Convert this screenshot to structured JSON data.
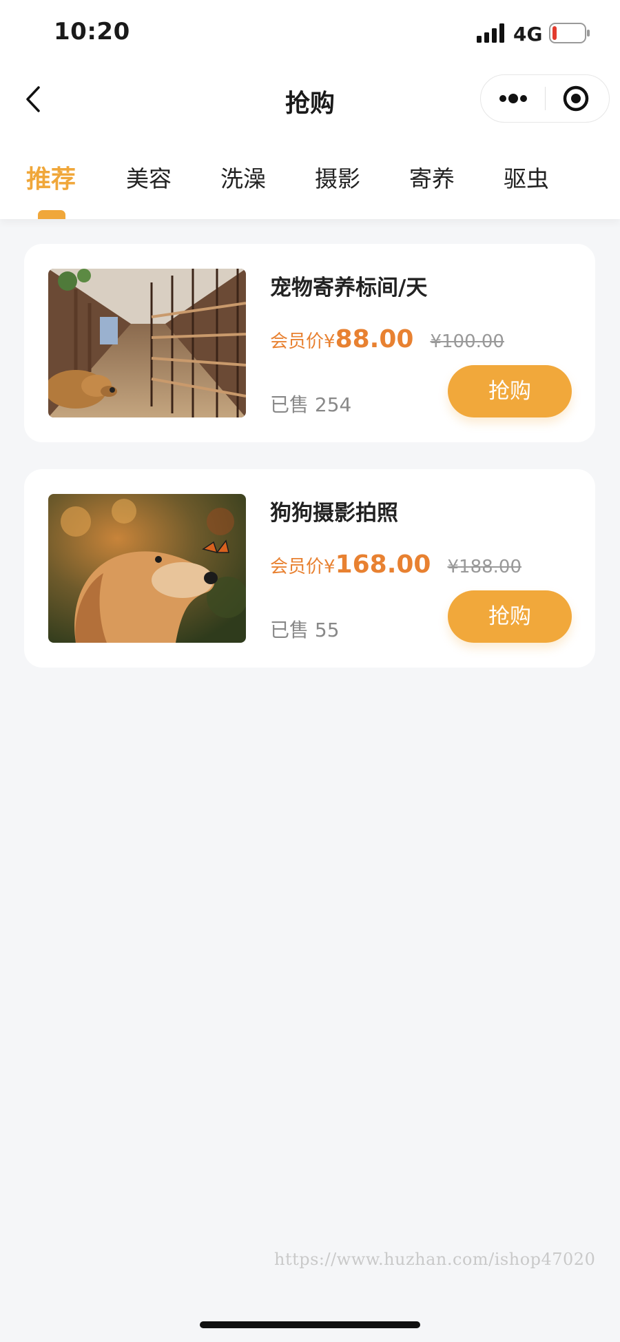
{
  "status_bar": {
    "time": "10:20",
    "network": "4G",
    "signal_icon": "signal-bars-icon",
    "battery_icon": "battery-low-icon",
    "battery_color": "#e23b2e"
  },
  "nav": {
    "title": "抢购",
    "back_icon": "chevron-left-icon",
    "more_icon": "more-dots-icon",
    "close_icon": "target-circle-icon"
  },
  "tabs": [
    {
      "label": "推荐",
      "active": true
    },
    {
      "label": "美容",
      "active": false
    },
    {
      "label": "洗澡",
      "active": false
    },
    {
      "label": "摄影",
      "active": false
    },
    {
      "label": "寄养",
      "active": false
    },
    {
      "label": "驱虫",
      "active": false
    }
  ],
  "colors": {
    "accent": "#f0a73a",
    "price": "#e88131",
    "background": "#f5f6f8"
  },
  "products": [
    {
      "title": "宠物寄养标间/天",
      "member_label": "会员价",
      "currency": "¥",
      "price": "88.00",
      "original_price": "¥100.00",
      "sold": "已售 254",
      "button": "抢购"
    },
    {
      "title": "狗狗摄影拍照",
      "member_label": "会员价",
      "currency": "¥",
      "price": "168.00",
      "original_price": "¥188.00",
      "sold": "已售 55",
      "button": "抢购"
    }
  ],
  "watermark": "https://www.huzhan.com/ishop47020"
}
